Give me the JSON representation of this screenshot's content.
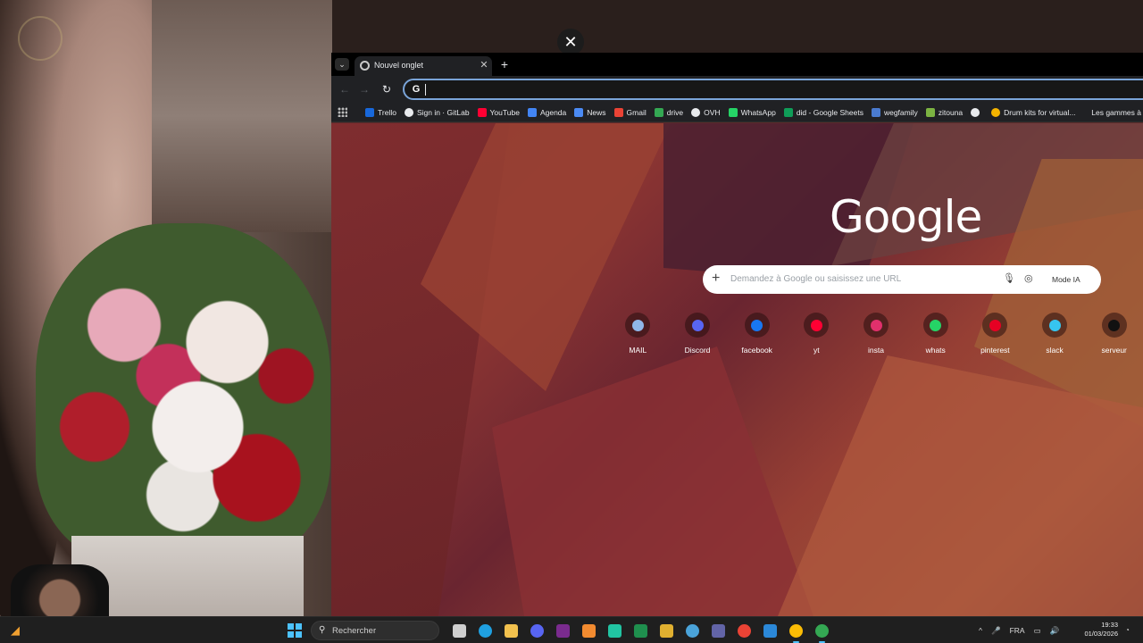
{
  "overlay": {
    "close_glyph": "✕"
  },
  "browser": {
    "tab": {
      "title": "Nouvel onglet",
      "close_glyph": "✕"
    },
    "new_tab_glyph": "+",
    "tab_menu_glyph": "⌄",
    "nav": {
      "back": "←",
      "forward": "→",
      "reload": "↻"
    },
    "omnibox": {
      "g_glyph": "G",
      "value": ""
    },
    "bookmarks": [
      {
        "label": "Trello",
        "icon": "trello-icon",
        "color": "#1868db"
      },
      {
        "label": "Sign in · GitLab",
        "icon": "gitlab-icon",
        "color": "#e8eaed"
      },
      {
        "label": "YouTube",
        "icon": "youtube-icon",
        "color": "#ff0033"
      },
      {
        "label": "Agenda",
        "icon": "calendar-icon",
        "color": "#4285f4"
      },
      {
        "label": "News",
        "icon": "news-icon",
        "color": "#4b8bf4"
      },
      {
        "label": "Gmail",
        "icon": "gmail-icon",
        "color": "#ea4335"
      },
      {
        "label": "drive",
        "icon": "drive-icon",
        "color": "#34a853"
      },
      {
        "label": "OVH",
        "icon": "ovh-icon",
        "color": "#e8eaed"
      },
      {
        "label": "WhatsApp",
        "icon": "whatsapp-icon",
        "color": "#25d366"
      },
      {
        "label": "did - Google Sheets",
        "icon": "sheets-icon",
        "color": "#0f9d58"
      },
      {
        "label": "wegfamily",
        "icon": "image-icon",
        "color": "#4a7bd0"
      },
      {
        "label": "zitouna",
        "icon": "leaf-icon",
        "color": "#7cb342"
      },
      {
        "label": "",
        "icon": "globe-icon",
        "color": "#e8eaed"
      },
      {
        "label": "Drum kits for virtual...",
        "icon": "drum-icon",
        "color": "#f4b400"
      }
    ],
    "bookmarks_overflow": "Les gammes à"
  },
  "newtab": {
    "logo": "Google",
    "search": {
      "placeholder": "Demandez à Google ou saisissez une URL",
      "plus_glyph": "+",
      "mic_glyph": "🎙",
      "lens_glyph": "◎",
      "mode_label": "Mode IA"
    },
    "shortcuts": [
      {
        "label": "MAIL",
        "icon": "mail-icon",
        "color": "#8fb6e8"
      },
      {
        "label": "Discord",
        "icon": "discord-icon",
        "color": "#5865f2"
      },
      {
        "label": "facebook",
        "icon": "facebook-icon",
        "color": "#1877f2"
      },
      {
        "label": "yt",
        "icon": "youtube-icon",
        "color": "#ff0033"
      },
      {
        "label": "insta",
        "icon": "instagram-icon",
        "color": "#e1306c"
      },
      {
        "label": "whats",
        "icon": "whatsapp-icon",
        "color": "#25d366"
      },
      {
        "label": "pinterest",
        "icon": "pinterest-icon",
        "color": "#e60023"
      },
      {
        "label": "slack",
        "icon": "slack-icon",
        "color": "#36c5f0"
      },
      {
        "label": "serveur",
        "icon": "tiktok-icon",
        "color": "#111111"
      }
    ]
  },
  "taskbar": {
    "search_placeholder": "Rechercher",
    "apps": [
      {
        "name": "task-view-icon",
        "color": "#cfcfcf",
        "active": false
      },
      {
        "name": "edge-icon",
        "color": "#1fa0e0",
        "active": false
      },
      {
        "name": "file-explorer-icon",
        "color": "#f2c14e",
        "active": false
      },
      {
        "name": "discord-icon",
        "color": "#5865f2",
        "active": false
      },
      {
        "name": "vegas-icon",
        "color": "#7a2b8e",
        "active": false
      },
      {
        "name": "shield-icon",
        "color": "#f28b30",
        "active": false
      },
      {
        "name": "app-green-icon",
        "color": "#21c4a2",
        "active": false
      },
      {
        "name": "excel-icon",
        "color": "#1f8f4e",
        "active": false
      },
      {
        "name": "layers-icon",
        "color": "#e0b030",
        "active": false
      },
      {
        "name": "globe-app-icon",
        "color": "#4aa3d9",
        "active": false
      },
      {
        "name": "teams-icon",
        "color": "#6264a7",
        "active": false
      },
      {
        "name": "chrome-icon",
        "color": "#ea4335",
        "active": false
      },
      {
        "name": "notepad-icon",
        "color": "#2b88d8",
        "active": false
      },
      {
        "name": "chrome-profile-icon",
        "color": "#fbbc05",
        "active": true
      },
      {
        "name": "chrome-active-icon",
        "color": "#34a853",
        "active": true
      }
    ],
    "tray": {
      "chevron": "^",
      "mic": "🎤",
      "lang": "FRA",
      "net": "▭",
      "vol": "🔊"
    },
    "clock": {
      "time": "19:33",
      "date": "01/03/2026"
    },
    "notif_glyph": "◔"
  }
}
